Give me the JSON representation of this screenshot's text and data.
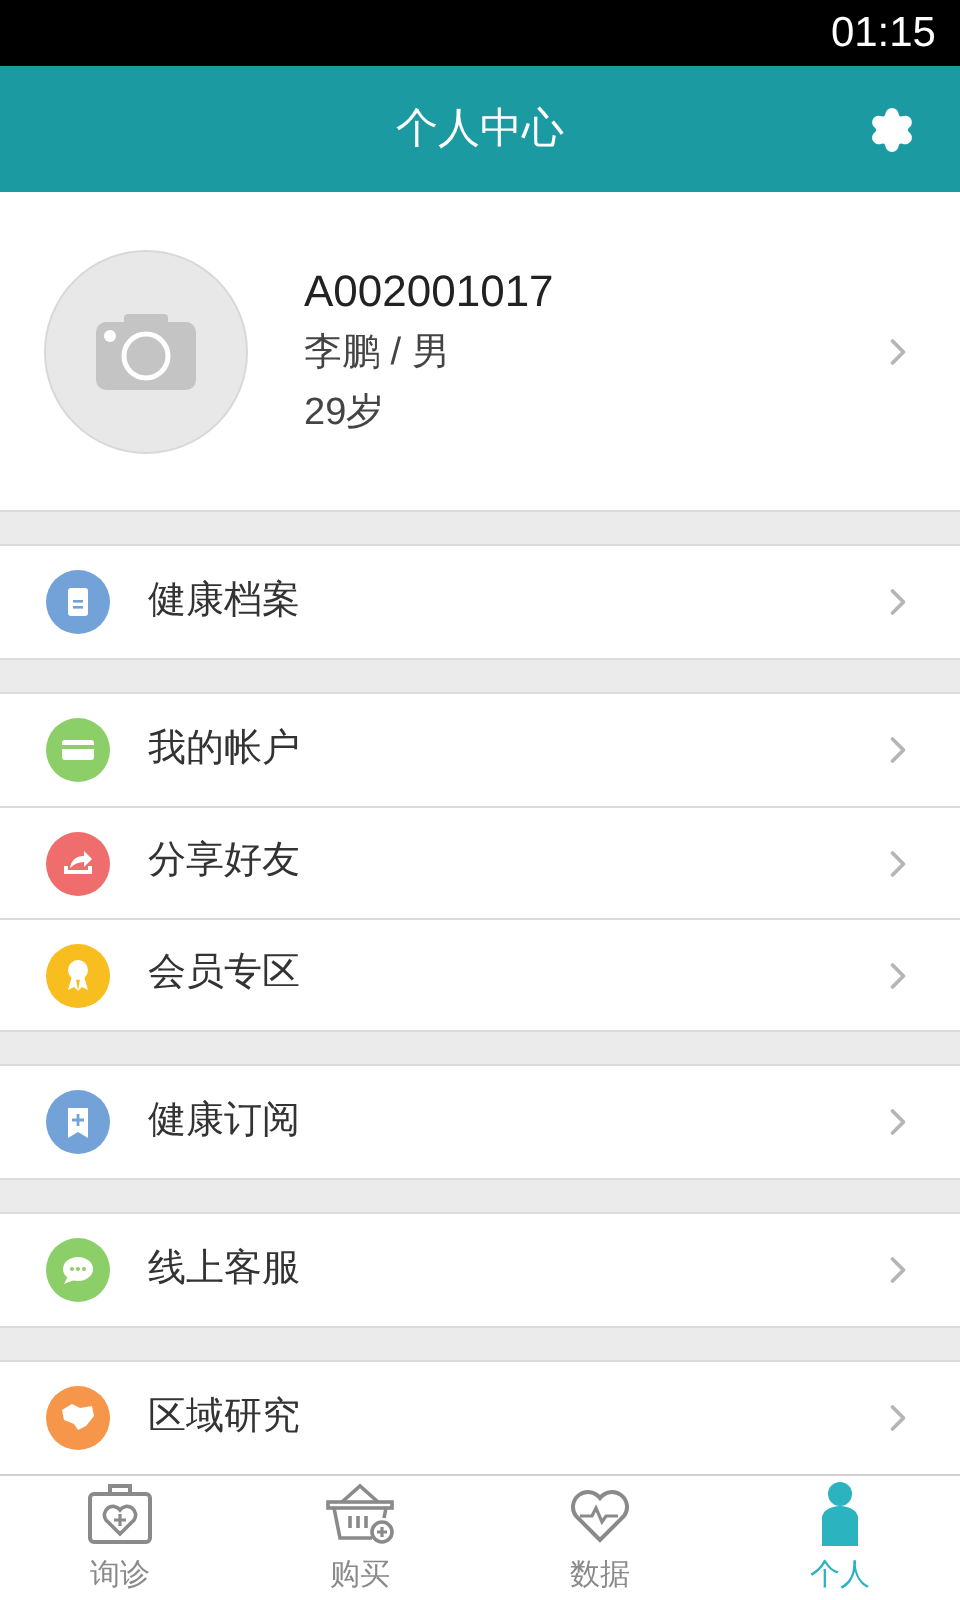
{
  "status_bar": {
    "time": "01:15"
  },
  "header": {
    "title": "个人中心"
  },
  "profile": {
    "id": "A002001017",
    "name_gender": "李鹏 / 男",
    "age": "29岁"
  },
  "groups": [
    {
      "items": [
        {
          "label": "健康档案",
          "kind": "document",
          "color": "#73a2d9"
        }
      ]
    },
    {
      "items": [
        {
          "label": "我的帐户",
          "kind": "card",
          "color": "#8ccf68"
        },
        {
          "label": "分享好友",
          "kind": "share",
          "color": "#ef6d6d"
        },
        {
          "label": "会员专区",
          "kind": "award",
          "color": "#f8bd1e"
        }
      ]
    },
    {
      "items": [
        {
          "label": "健康订阅",
          "kind": "bookmark",
          "color": "#73a2d9"
        }
      ]
    },
    {
      "items": [
        {
          "label": "线上客服",
          "kind": "chat",
          "color": "#8ccf68"
        }
      ]
    },
    {
      "items": [
        {
          "label": "区域研究",
          "kind": "map",
          "color": "#f5964a"
        }
      ]
    }
  ],
  "tabs": [
    {
      "label": "询诊",
      "kind": "kit",
      "selected": false
    },
    {
      "label": "购买",
      "kind": "basket",
      "selected": false
    },
    {
      "label": "数据",
      "kind": "heart",
      "selected": false
    },
    {
      "label": "个人",
      "kind": "person",
      "selected": true
    }
  ]
}
